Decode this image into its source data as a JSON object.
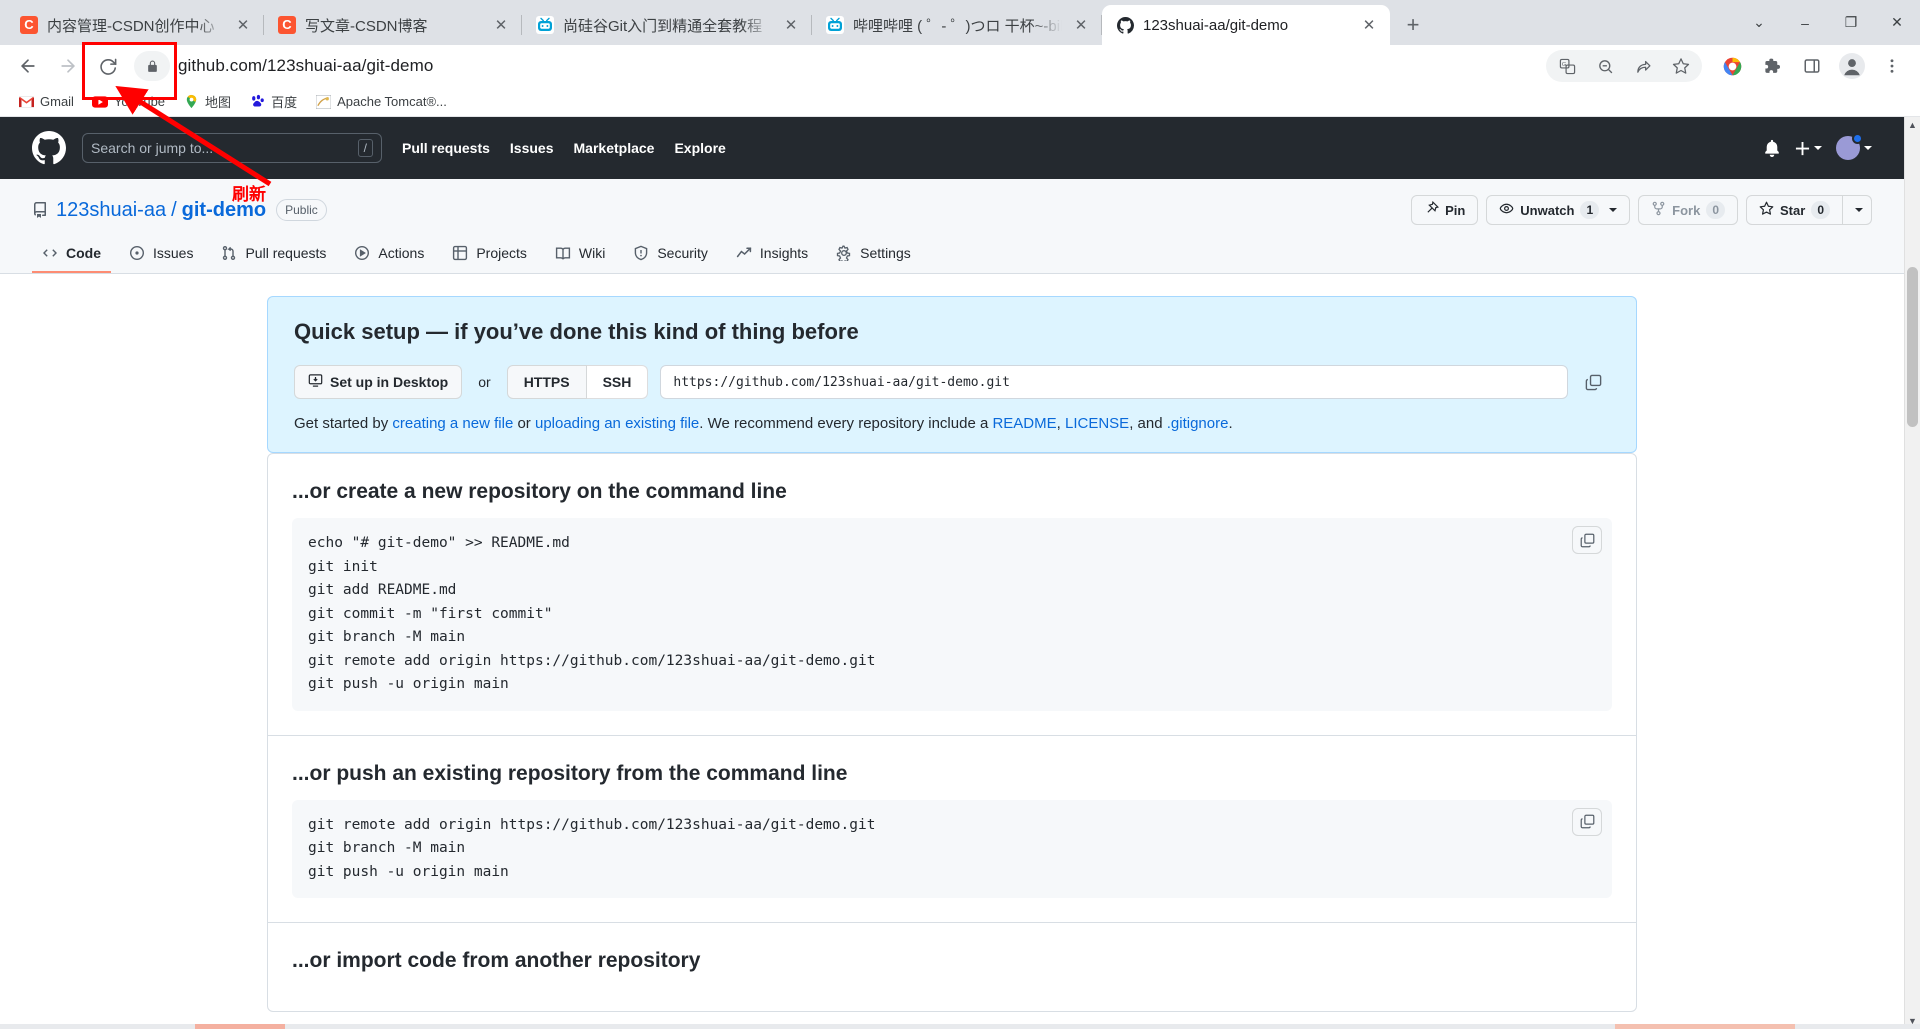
{
  "browser": {
    "tabs": [
      {
        "title": "内容管理-CSDN创作中心",
        "favicon": "csdn-icon",
        "active": false
      },
      {
        "title": "写文章-CSDN博客",
        "favicon": "csdn-icon",
        "active": false
      },
      {
        "title": "尚硅谷Git入门到精通全套教程（",
        "favicon": "bilibili-icon",
        "active": false
      },
      {
        "title": "哔哩哔哩 ( ゜- ゜)つロ 干杯~-bili",
        "favicon": "bilibili-icon",
        "active": false
      },
      {
        "title": "123shuai-aa/git-demo",
        "favicon": "github-icon",
        "active": true
      }
    ],
    "new_tab_label": "+",
    "close_label": "✕",
    "window_controls": {
      "list": "⌄",
      "minimize": "–",
      "maximize": "❐",
      "close": "✕"
    },
    "nav": {
      "back": "←",
      "forward": "→",
      "reload": "⟳"
    },
    "omnibox": {
      "url": "github.com/123shuai-aa/git-demo",
      "lock": "lock-icon"
    },
    "toolbar_icons": [
      "translate-icon",
      "zoom-out-icon",
      "share-icon",
      "bookmark-star-icon",
      "chrome-profile-icon",
      "extensions-puzzle-icon",
      "side-panel-icon",
      "profile-avatar-icon",
      "menu-kebab-icon"
    ],
    "bookmarks": [
      {
        "label": "Gmail",
        "icon": "gmail-icon"
      },
      {
        "label": "YouTube",
        "icon": "youtube-icon"
      },
      {
        "label": "地图",
        "icon": "maps-icon"
      },
      {
        "label": "百度",
        "icon": "baidu-icon"
      },
      {
        "label": "Apache Tomcat®...",
        "icon": "tomcat-icon"
      }
    ]
  },
  "annotation": {
    "label": "刷新",
    "color": "#ff0000"
  },
  "github": {
    "header": {
      "logo": "github-mark-icon",
      "search_placeholder": "Search or jump to...",
      "search_shortcut": "/",
      "nav": [
        "Pull requests",
        "Issues",
        "Marketplace",
        "Explore"
      ],
      "notifications": "bell-icon",
      "create_new": "plus-icon",
      "avatar": "user-avatar"
    },
    "repo": {
      "icon": "repo-icon",
      "owner": "123shuai-aa",
      "separator": "/",
      "name": "git-demo",
      "visibility": "Public",
      "actions": {
        "pin": {
          "label": "Pin",
          "icon": "pin-icon"
        },
        "watch": {
          "label": "Unwatch",
          "count": "1",
          "icon": "eye-icon"
        },
        "fork": {
          "label": "Fork",
          "count": "0",
          "icon": "fork-icon"
        },
        "star": {
          "label": "Star",
          "count": "0",
          "icon": "star-icon"
        }
      },
      "tabs": [
        {
          "label": "Code",
          "icon": "code-icon",
          "selected": true
        },
        {
          "label": "Issues",
          "icon": "issue-opened-icon",
          "selected": false
        },
        {
          "label": "Pull requests",
          "icon": "git-pull-request-icon",
          "selected": false
        },
        {
          "label": "Actions",
          "icon": "play-icon",
          "selected": false
        },
        {
          "label": "Projects",
          "icon": "table-icon",
          "selected": false
        },
        {
          "label": "Wiki",
          "icon": "book-icon",
          "selected": false
        },
        {
          "label": "Security",
          "icon": "shield-icon",
          "selected": false
        },
        {
          "label": "Insights",
          "icon": "graph-icon",
          "selected": false
        },
        {
          "label": "Settings",
          "icon": "gear-icon",
          "selected": false
        }
      ]
    },
    "quick_setup": {
      "heading": "Quick setup — if you’ve done this kind of thing before",
      "desktop_button": "Set up in Desktop",
      "or": "or",
      "protocols": [
        "HTTPS",
        "SSH"
      ],
      "clone_url": "https://github.com/123shuai-aa/git-demo.git",
      "copy_icon": "copy-icon",
      "get_started": {
        "prefix": "Get started by ",
        "link1": "creating a new file",
        "mid1": " or ",
        "link2": "uploading an existing file",
        "mid2": ". We recommend every repository include a ",
        "link3": "README",
        "mid3": ", ",
        "link4": "LICENSE",
        "mid4": ", and ",
        "link5": ".gitignore",
        "suffix": "."
      }
    },
    "sections": [
      {
        "heading": "...or create a new repository on the command line",
        "code": "echo \"# git-demo\" >> README.md\ngit init\ngit add README.md\ngit commit -m \"first commit\"\ngit branch -M main\ngit remote add origin https://github.com/123shuai-aa/git-demo.git\ngit push -u origin main"
      },
      {
        "heading": "...or push an existing repository from the command line",
        "code": "git remote add origin https://github.com/123shuai-aa/git-demo.git\ngit branch -M main\ngit push -u origin main"
      },
      {
        "heading": "...or import code from another repository",
        "code": ""
      }
    ]
  },
  "colors": {
    "github_dark": "#24292f",
    "accent_blue": "#0969da",
    "quick_setup_bg": "#ddf4ff",
    "annotation_red": "#ff0000",
    "tab_selected_underline": "#fd8c73"
  }
}
